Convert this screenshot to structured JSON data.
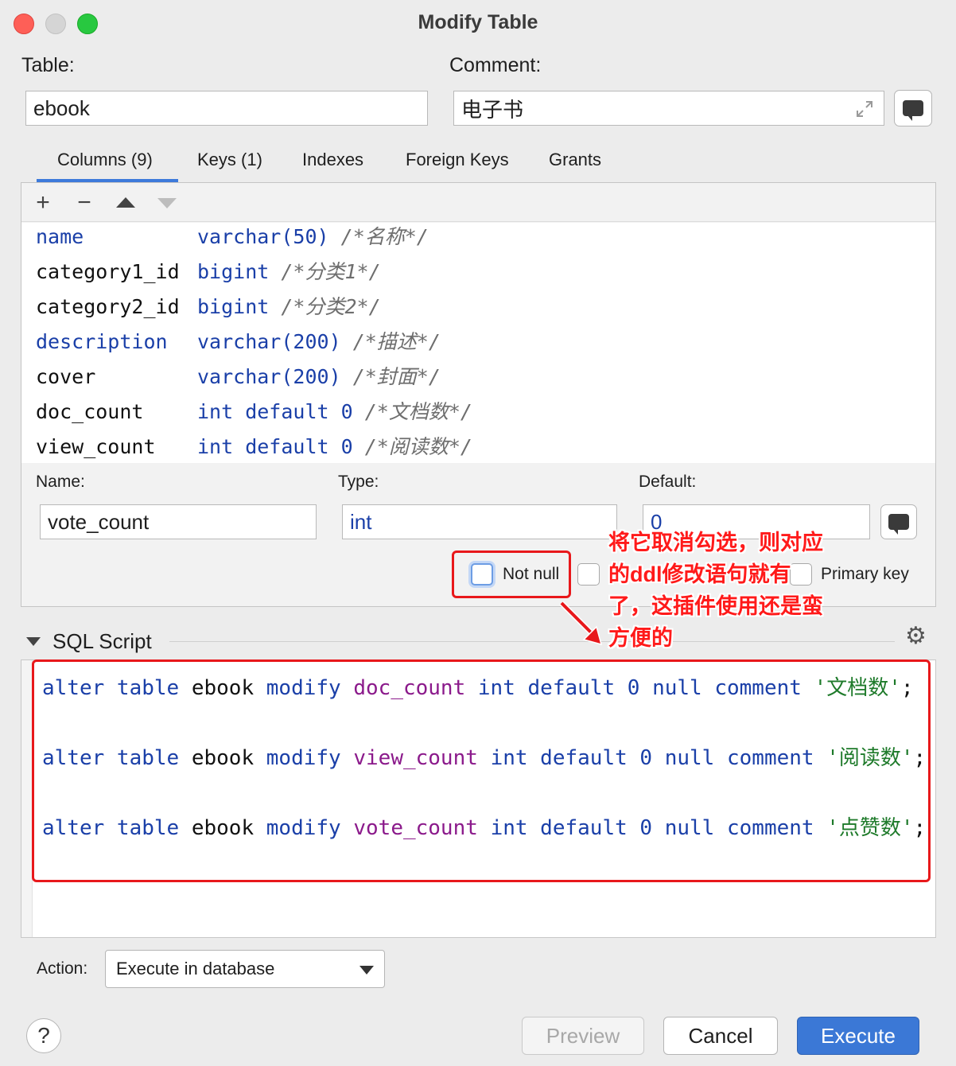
{
  "window": {
    "title": "Modify Table"
  },
  "table": {
    "label": "Table:",
    "value": "ebook"
  },
  "comment": {
    "label": "Comment:",
    "value": "电子书"
  },
  "tabs": [
    {
      "label": "Columns (9)",
      "active": true
    },
    {
      "label": "Keys (1)"
    },
    {
      "label": "Indexes"
    },
    {
      "label": "Foreign Keys"
    },
    {
      "label": "Grants"
    }
  ],
  "toolbar": {
    "add": "+",
    "remove": "−"
  },
  "columns": [
    {
      "name": "name",
      "type": "varchar(",
      "num": "50",
      "tail": ")",
      "comment": "/*名称*/"
    },
    {
      "name": "category1_id",
      "type": "bigint",
      "num": "",
      "tail": "",
      "comment": "/*分类1*/"
    },
    {
      "name": "category2_id",
      "type": "bigint",
      "num": "",
      "tail": "",
      "comment": "/*分类2*/"
    },
    {
      "name": "description",
      "type": "varchar(",
      "num": "200",
      "tail": ")",
      "comment": "/*描述*/"
    },
    {
      "name": "cover",
      "type": "varchar(",
      "num": "200",
      "tail": ")",
      "comment": "/*封面*/"
    },
    {
      "name": "doc_count",
      "type": "int default ",
      "num": "0",
      "tail": "",
      "comment": "/*文档数*/"
    },
    {
      "name": "view_count",
      "type": "int default ",
      "num": "0",
      "tail": "",
      "comment": "/*阅读数*/"
    }
  ],
  "editor": {
    "name_label": "Name:",
    "name_value": "vote_count",
    "type_label": "Type:",
    "type_value": "int",
    "default_label": "Default:",
    "default_value": "0",
    "not_null_label": "Not null",
    "primary_key_label": "Primary key"
  },
  "sql": {
    "title": "SQL Script",
    "lines": [
      {
        "kw1": "alter table",
        "tbl": "ebook",
        "kw2": "modify",
        "col": "doc_count",
        "type": "int default",
        "num": "0",
        "kw3": "null comment",
        "str": "'文档数'",
        "end": ";"
      },
      {
        "kw1": "alter table",
        "tbl": "ebook",
        "kw2": "modify",
        "col": "view_count",
        "type": "int default",
        "num": "0",
        "kw3": "null comment",
        "str": "'阅读数'",
        "end": ";"
      },
      {
        "kw1": "alter table",
        "tbl": "ebook",
        "kw2": "modify",
        "col": "vote_count",
        "type": "int default",
        "num": "0",
        "kw3": "null comment",
        "str": "'点赞数'",
        "end": ";"
      }
    ]
  },
  "annotation": {
    "lines": [
      "将它取消勾选，则对应",
      "的ddl修改语句就有",
      "了，这插件使用还是蛮",
      "方便的"
    ]
  },
  "action": {
    "label": "Action:",
    "value": "Execute in database"
  },
  "buttons": {
    "help": "?",
    "preview": "Preview",
    "cancel": "Cancel",
    "execute": "Execute"
  },
  "colors": {
    "accent": "#3b78d6",
    "annotation_red": "#e8181b"
  }
}
